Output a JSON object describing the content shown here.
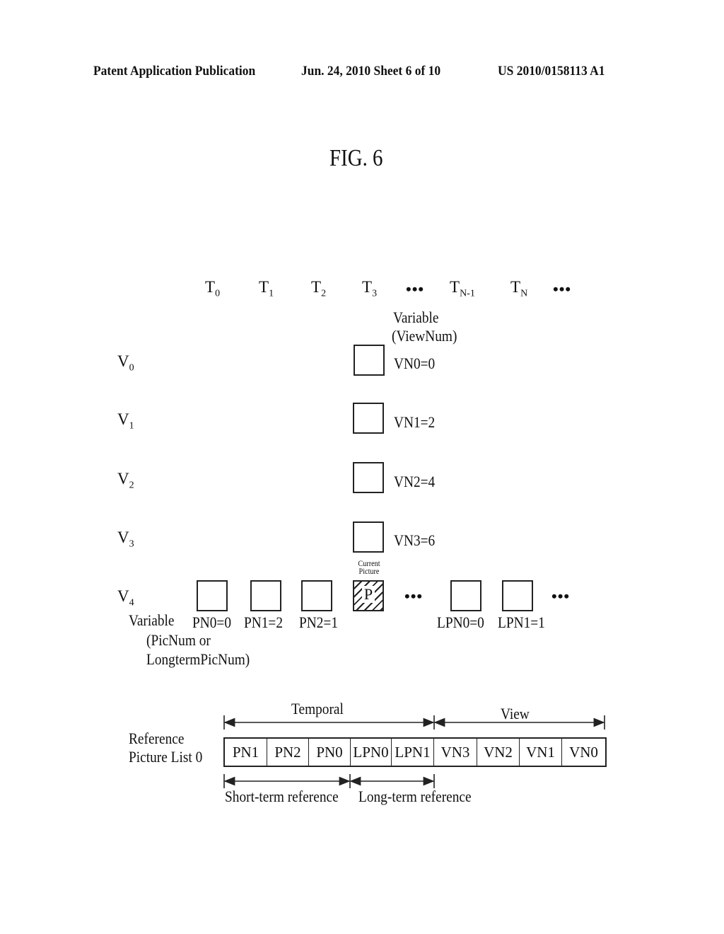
{
  "header": {
    "left": "Patent Application Publication",
    "center": "Jun. 24, 2010  Sheet 6 of 10",
    "right": "US 2010/0158113 A1"
  },
  "figure": {
    "title": "FIG. 6",
    "time_axis": [
      {
        "base": "T",
        "sub": "0"
      },
      {
        "base": "T",
        "sub": "1"
      },
      {
        "base": "T",
        "sub": "2"
      },
      {
        "base": "T",
        "sub": "3"
      },
      {
        "base": "T",
        "sub": "N-1"
      },
      {
        "base": "T",
        "sub": "N"
      }
    ],
    "ellipsis": "•••",
    "view_variable_label_1": "Variable",
    "view_variable_label_2": "(ViewNum)",
    "views": [
      {
        "base": "V",
        "sub": "0",
        "value": "VN0=0"
      },
      {
        "base": "V",
        "sub": "1",
        "value": "VN1=2"
      },
      {
        "base": "V",
        "sub": "2",
        "value": "VN2=4"
      },
      {
        "base": "V",
        "sub": "3",
        "value": "VN3=6"
      },
      {
        "base": "V",
        "sub": "4"
      }
    ],
    "current_picture_label_1": "Current",
    "current_picture_label_2": "Picture",
    "current_picture_glyph": "P",
    "pic_variable_label": [
      "Variable",
      "(PicNum or",
      "LongtermPicNum)"
    ],
    "pic_values": [
      "PN0=0",
      "PN1=2",
      "PN2=1",
      "LPN0=0",
      "LPN1=1"
    ],
    "reference_list": {
      "label_1": "Reference",
      "label_2": "Picture List 0",
      "temporal_label": "Temporal",
      "view_label": "View",
      "short_term_label": "Short-term reference",
      "long_term_label": "Long-term reference",
      "cells": [
        "PN1",
        "PN2",
        "PN0",
        "LPN0",
        "LPN1",
        "VN3",
        "VN2",
        "VN1",
        "VN0"
      ]
    }
  }
}
